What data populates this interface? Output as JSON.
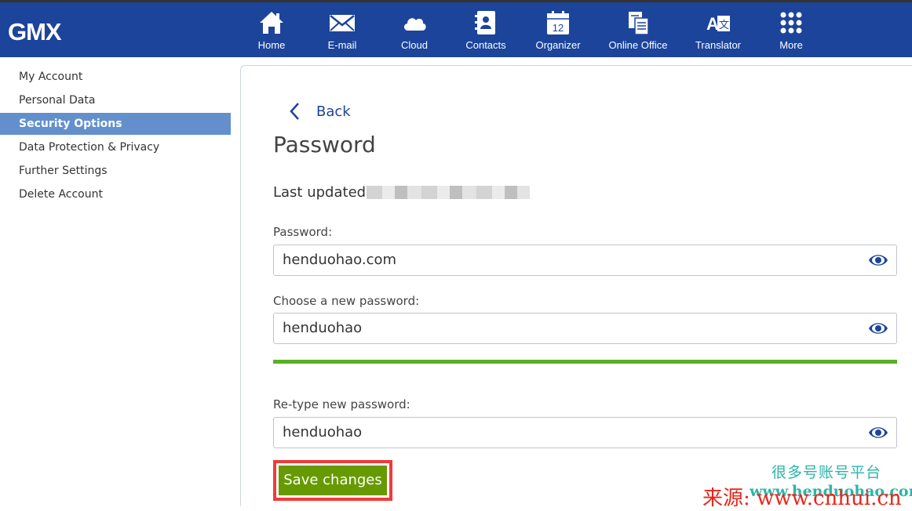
{
  "app": {
    "logo": "GMX"
  },
  "nav": [
    {
      "label": "Home",
      "icon": "home-icon"
    },
    {
      "label": "E-mail",
      "icon": "mail-icon"
    },
    {
      "label": "Cloud",
      "icon": "cloud-icon"
    },
    {
      "label": "Contacts",
      "icon": "contacts-icon"
    },
    {
      "label": "Organizer",
      "icon": "calendar-icon",
      "badge": "12"
    },
    {
      "label": "Online Office",
      "icon": "office-icon"
    },
    {
      "label": "Translator",
      "icon": "translate-icon"
    },
    {
      "label": "More",
      "icon": "grid-icon"
    }
  ],
  "sidebar": {
    "items": [
      {
        "label": "My Account"
      },
      {
        "label": "Personal Data"
      },
      {
        "label": "Security Options",
        "active": true
      },
      {
        "label": "Data Protection & Privacy"
      },
      {
        "label": "Further Settings"
      },
      {
        "label": "Delete Account"
      }
    ]
  },
  "main": {
    "back_label": "Back",
    "title": "Password",
    "last_updated_label": "Last updated",
    "current_password": {
      "label": "Password:",
      "value": "henduohao.com"
    },
    "new_password": {
      "label": "Choose a new password:",
      "value": "henduohao"
    },
    "strength_color": "#5ab025",
    "retype_password": {
      "label": "Re-type new password:",
      "value": "henduohao"
    },
    "save_label": "Save changes"
  },
  "watermark": {
    "line1": "很多号账号平台",
    "line2": "www.henduohao.com",
    "line3": "来源: www.cnhui.cn"
  },
  "colors": {
    "brand": "#1c449b",
    "active_item": "#6390cc",
    "save_button": "#669a00",
    "highlight": "#f23a3a"
  }
}
